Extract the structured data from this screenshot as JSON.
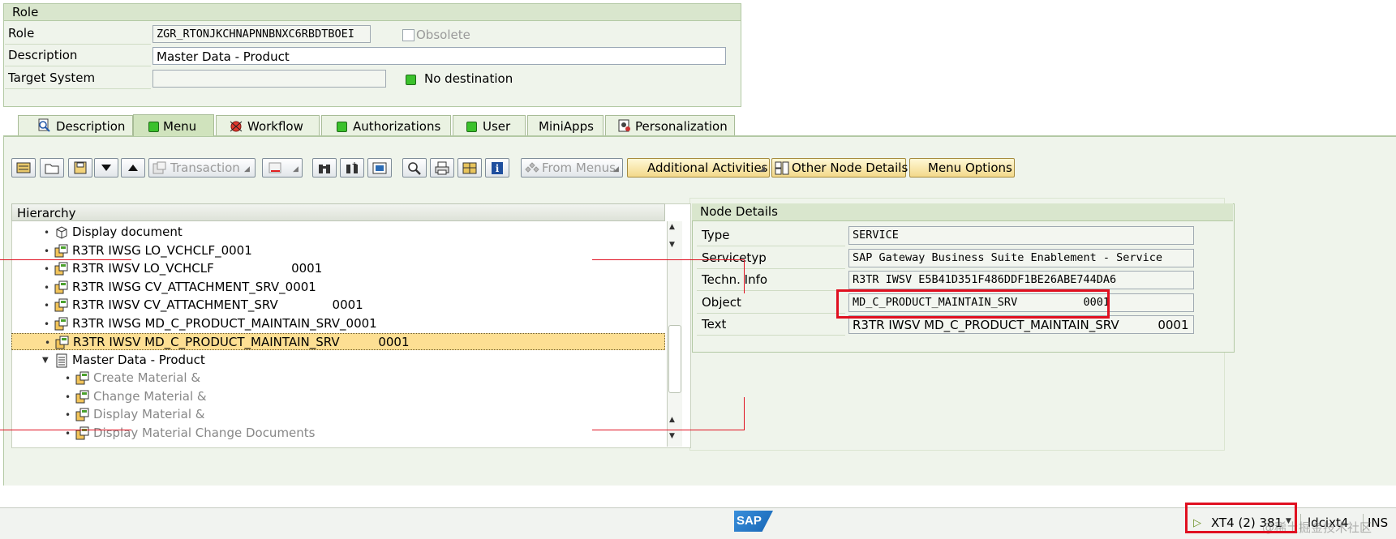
{
  "role_section": {
    "title": "Role",
    "role_label": "Role",
    "role_value": "ZGR_RTONJKCHNAPNNBNXC6RBDTBOEI",
    "obsolete_label": "Obsolete",
    "description_label": "Description",
    "description_value": "Master Data - Product",
    "target_system_label": "Target System",
    "target_system_value": "",
    "destination_status": "No destination"
  },
  "tabs": [
    {
      "label": "Description",
      "icon": "magnifier-doc-icon"
    },
    {
      "label": "Menu",
      "icon": "led-green-icon",
      "active": true
    },
    {
      "label": "Workflow",
      "icon": "led-red-icon"
    },
    {
      "label": "Authorizations",
      "icon": "led-green-icon"
    },
    {
      "label": "User",
      "icon": "led-green-icon"
    },
    {
      "label": "MiniApps",
      "icon": ""
    },
    {
      "label": "Personalization",
      "icon": "personalization-icon"
    }
  ],
  "toolbar": {
    "transaction_label": "Transaction",
    "from_menus_label": "From Menus",
    "additional_activities_label": "Additional Activities",
    "other_node_details_label": "Other Node Details",
    "menu_options_label": "Menu Options"
  },
  "hierarchy": {
    "title": "Hierarchy",
    "items": [
      {
        "text": "Display document",
        "indent": 1,
        "type": "doc"
      },
      {
        "text": "R3TR IWSG LO_VCHCLF_0001",
        "indent": 1,
        "type": "tx"
      },
      {
        "text": "R3TR IWSV LO_VCHCLF                    0001",
        "indent": 1,
        "type": "tx"
      },
      {
        "text": "R3TR IWSG CV_ATTACHMENT_SRV_0001",
        "indent": 1,
        "type": "tx"
      },
      {
        "text": "R3TR IWSV CV_ATTACHMENT_SRV              0001",
        "indent": 1,
        "type": "tx"
      },
      {
        "text": "R3TR IWSG MD_C_PRODUCT_MAINTAIN_SRV_0001",
        "indent": 1,
        "type": "tx"
      },
      {
        "text": "R3TR IWSV MD_C_PRODUCT_MAINTAIN_SRV          0001",
        "indent": 1,
        "type": "tx",
        "selected": true
      },
      {
        "text": "Master Data - Product",
        "indent": 1,
        "type": "folder",
        "expanded": true
      },
      {
        "text": "Create Material &",
        "indent": 2,
        "type": "tx",
        "dim": true
      },
      {
        "text": "Change Material &",
        "indent": 2,
        "type": "tx",
        "dim": true
      },
      {
        "text": "Display Material &",
        "indent": 2,
        "type": "tx",
        "dim": true
      },
      {
        "text": "Display Material Change Documents",
        "indent": 2,
        "type": "tx",
        "dim": true
      }
    ]
  },
  "node_details": {
    "title": "Node Details",
    "rows": [
      {
        "label": "Type",
        "value": "SERVICE"
      },
      {
        "label": "Servicetyp",
        "value": "SAP Gateway Business Suite Enablement - Service"
      },
      {
        "label": "Techn. Info",
        "value": "R3TR IWSV E5B41D351F486DDF1BE26ABE744DA6"
      },
      {
        "label": "Object",
        "value": "MD_C_PRODUCT_MAINTAIN_SRV          0001"
      },
      {
        "label": "Text",
        "value": "R3TR IWSV MD_C_PRODUCT_MAINTAIN_SRV          0001"
      }
    ]
  },
  "status_bar": {
    "logo": "SAP",
    "system": "XT4 (2) 381",
    "host": "ldcixt4",
    "mode": "INS",
    "watermark": "@稀土掘金技术社区"
  },
  "colors": {
    "accent_green": "#3bc12c",
    "highlight_red": "#e01020",
    "selected_row": "#fddf93"
  }
}
